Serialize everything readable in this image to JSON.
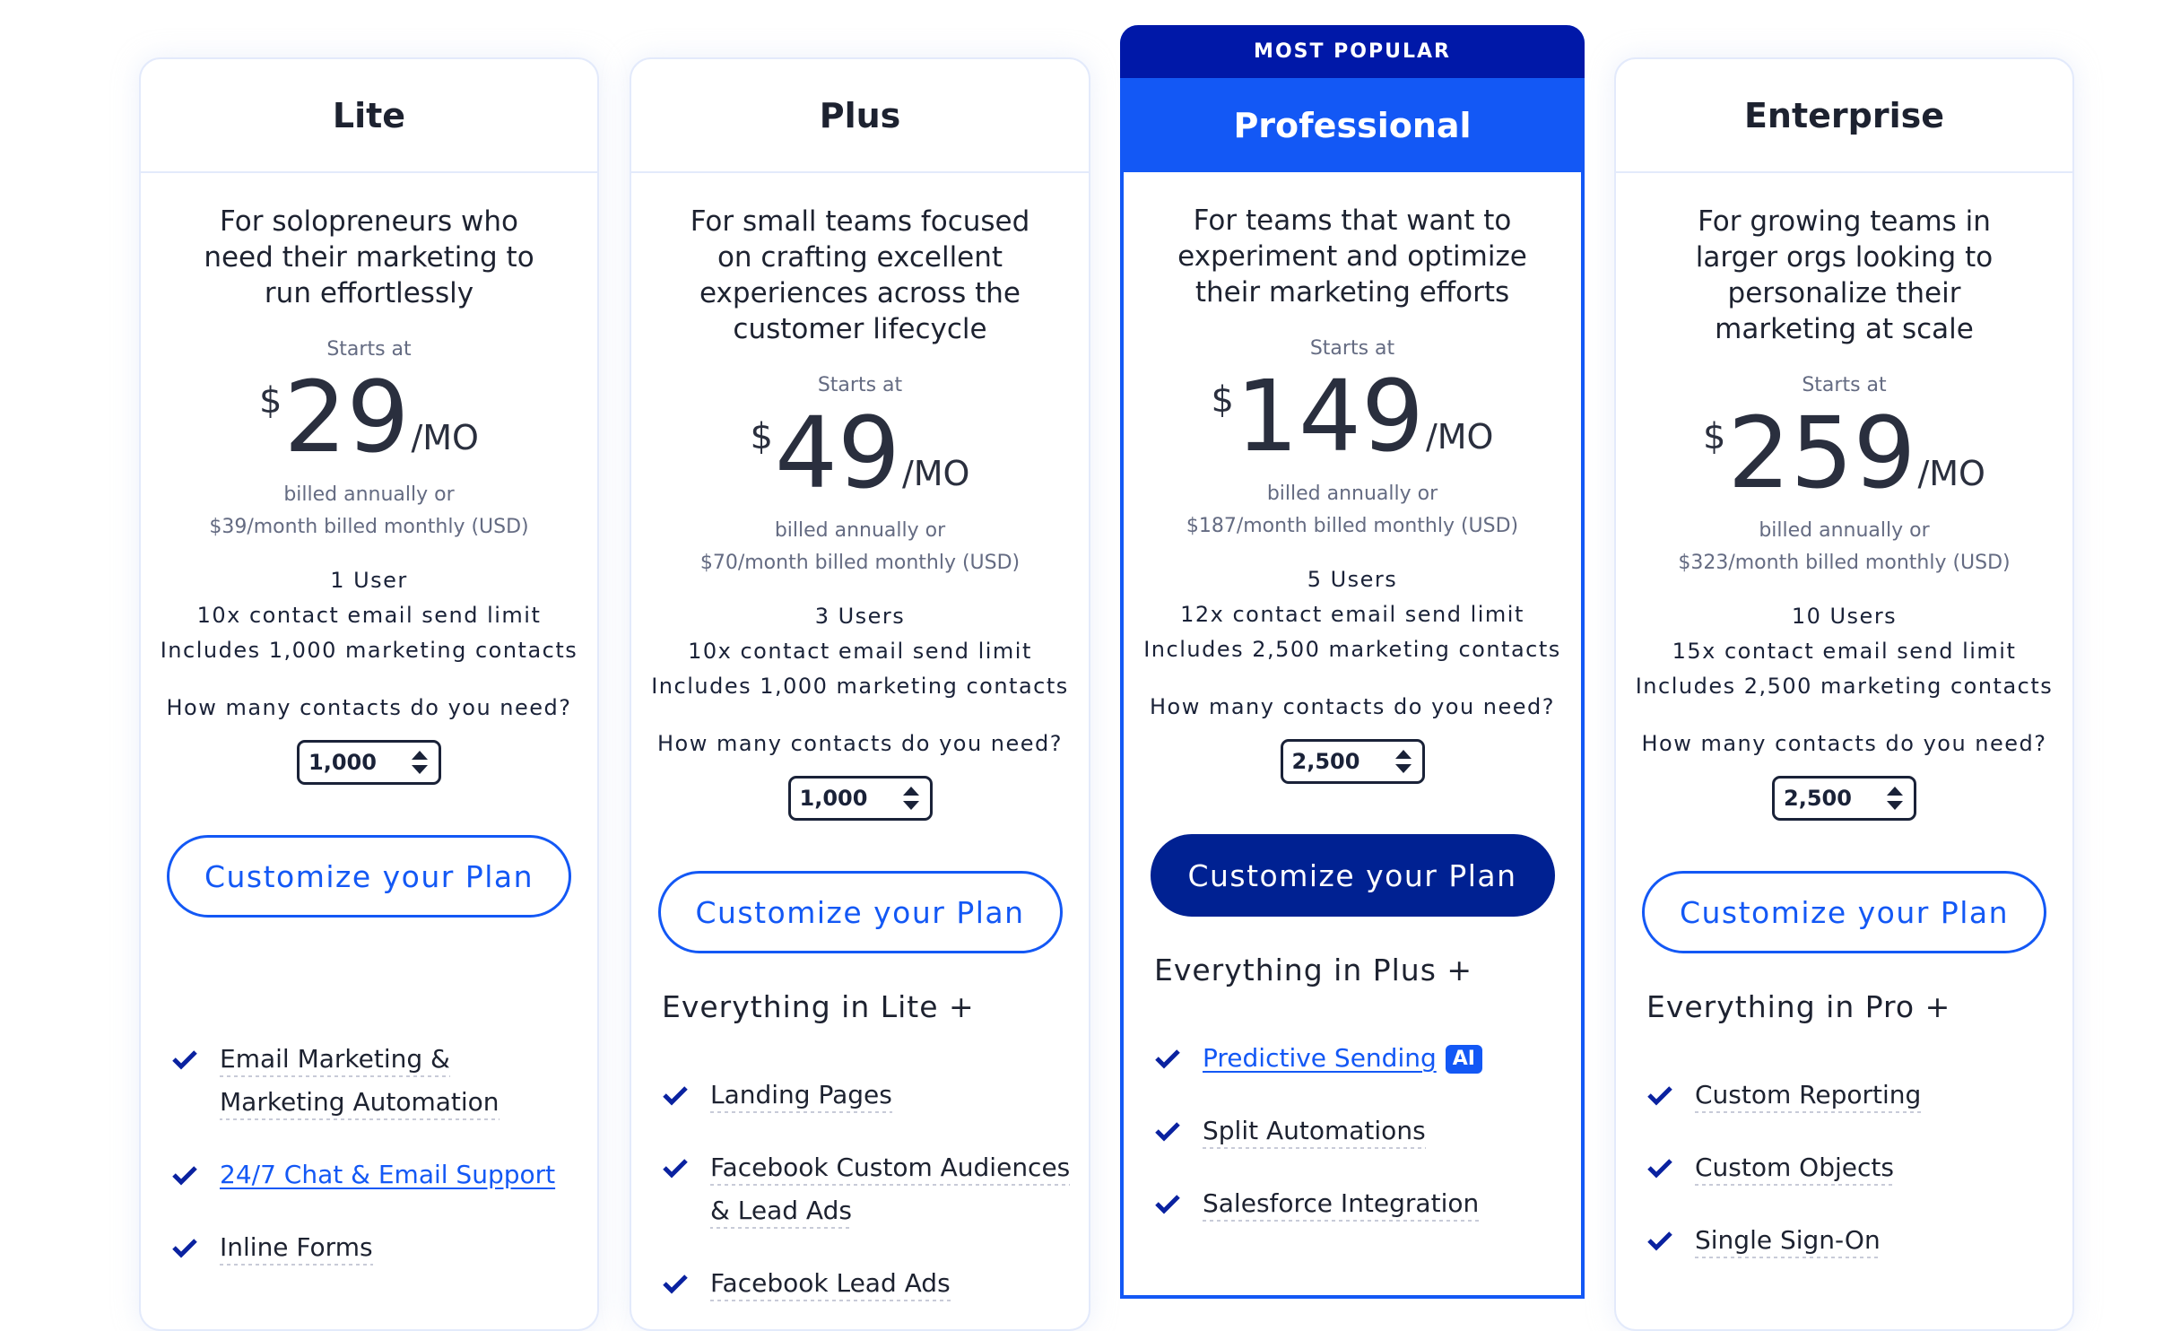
{
  "plans": [
    {
      "name": "Lite",
      "description": "For solopreneurs who need their marketing to run effortlessly",
      "starts_at": "Starts at",
      "currency": "$",
      "price": "29",
      "period": "/MO",
      "billed_line1": "billed annually or",
      "billed_line2": "$39/month billed monthly (USD)",
      "users": "1 User",
      "send_limit": "10x contact email send limit",
      "contacts_included": "Includes 1,000 marketing contacts",
      "contacts_question": "How many contacts do you need?",
      "contacts_value": "1,000",
      "cta": "Customize your Plan",
      "everything_in": "",
      "features": [
        {
          "text": "Email Marketing & Marketing Automation",
          "link": false
        },
        {
          "text": "24/7 Chat & Email Support",
          "link": true
        },
        {
          "text": "Inline Forms",
          "link": false
        }
      ]
    },
    {
      "name": "Plus",
      "description": "For small teams focused on crafting excellent experiences across the customer lifecycle",
      "starts_at": "Starts at",
      "currency": "$",
      "price": "49",
      "period": "/MO",
      "billed_line1": "billed annually or",
      "billed_line2": "$70/month billed monthly (USD)",
      "users": "3 Users",
      "send_limit": "10x contact email send limit",
      "contacts_included": "Includes 1,000 marketing contacts",
      "contacts_question": "How many contacts do you need?",
      "contacts_value": "1,000",
      "cta": "Customize your Plan",
      "everything_in": "Everything in Lite +",
      "features": [
        {
          "text": "Landing Pages",
          "link": false
        },
        {
          "text": "Facebook Custom Audiences & Lead Ads",
          "link": false
        },
        {
          "text": "Facebook Lead Ads",
          "link": false
        }
      ]
    },
    {
      "name": "Professional",
      "badge": "MOST POPULAR",
      "description": "For teams that want to experiment and optimize their marketing efforts",
      "starts_at": "Starts at",
      "currency": "$",
      "price": "149",
      "period": "/MO",
      "billed_line1": "billed annually or",
      "billed_line2": "$187/month billed monthly (USD)",
      "users": "5 Users",
      "send_limit": "12x contact email send limit",
      "contacts_included": "Includes 2,500 marketing contacts",
      "contacts_question": "How many contacts do you need?",
      "contacts_value": "2,500",
      "cta": "Customize your Plan",
      "everything_in": "Everything in Plus +",
      "features": [
        {
          "text": "Predictive Sending",
          "link": true,
          "tag": "AI"
        },
        {
          "text": "Split Automations",
          "link": false
        },
        {
          "text": "Salesforce Integration",
          "link": false
        }
      ]
    },
    {
      "name": "Enterprise",
      "description": "For growing teams in larger orgs looking to personalize their marketing at scale",
      "starts_at": "Starts at",
      "currency": "$",
      "price": "259",
      "period": "/MO",
      "billed_line1": "billed annually or",
      "billed_line2": "$323/month billed monthly (USD)",
      "users": "10 Users",
      "send_limit": "15x contact email send limit",
      "contacts_included": "Includes 2,500 marketing contacts",
      "contacts_question": "How many contacts do you need?",
      "contacts_value": "2,500",
      "cta": "Customize your Plan",
      "everything_in": "Everything in Pro +",
      "features": [
        {
          "text": "Custom Reporting",
          "link": false
        },
        {
          "text": "Custom Objects",
          "link": false
        },
        {
          "text": "Single Sign-On",
          "link": false
        }
      ]
    }
  ],
  "colors": {
    "accent": "#1358f5",
    "badge_navy": "#0018a8",
    "cta_filled": "#002192",
    "check": "#0a22a0",
    "text_dark": "#1d2230",
    "text_muted": "#646b82",
    "card_border": "#e3eafb"
  }
}
